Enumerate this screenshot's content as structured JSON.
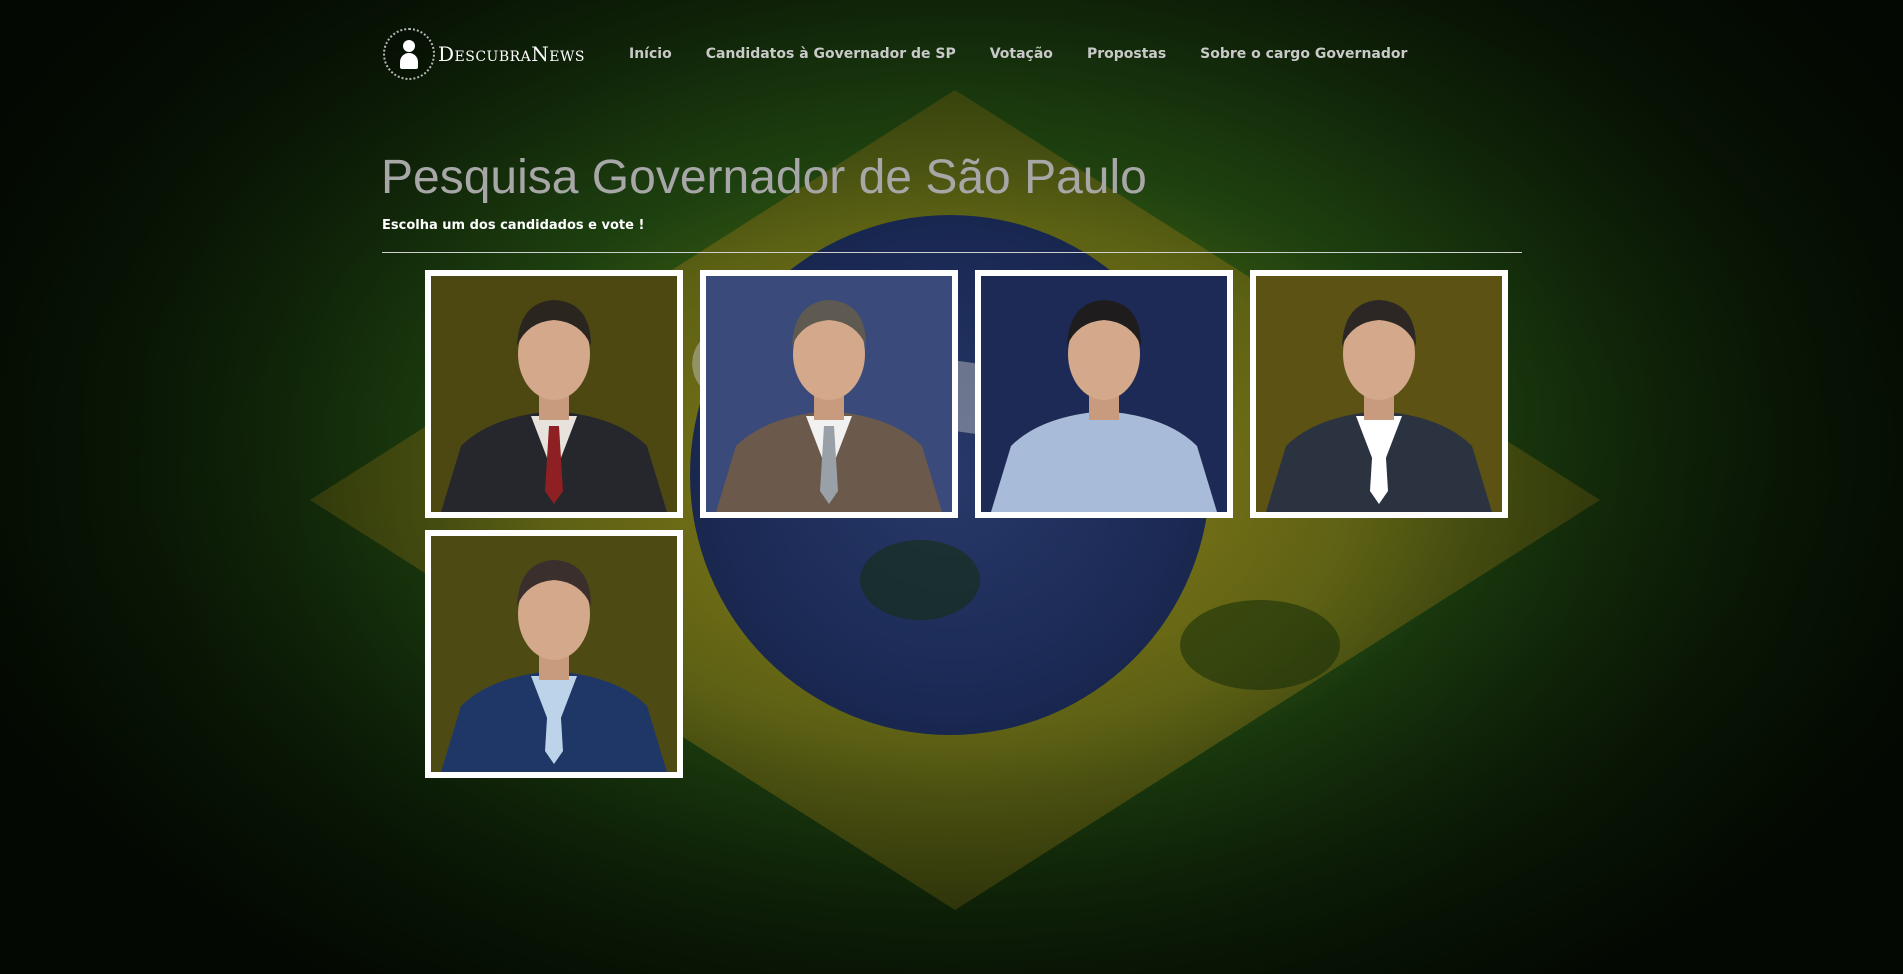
{
  "header": {
    "logo_text": "DescubraNews",
    "nav": [
      {
        "label": "Início"
      },
      {
        "label": "Candidatos à Governador de SP"
      },
      {
        "label": "Votação"
      },
      {
        "label": "Propostas"
      },
      {
        "label": "Sobre o cargo Governador"
      }
    ]
  },
  "hero": {
    "title": "Pesquisa Governador de São Paulo",
    "subtitle": "Escolha um dos candidados e vote !"
  },
  "candidates": [
    {
      "photo": "candidate-photo",
      "hair": "#2b2520",
      "suit": "#25272c",
      "shirt": "#e7e3dc",
      "tie": "#8e1f22",
      "bg": "#4d4812"
    },
    {
      "photo": "candidate-photo",
      "hair": "#5e5a52",
      "suit": "#6b5a4c",
      "shirt": "#f1f1f1",
      "tie": "#9aa0a8",
      "bg": "#3a4a7a"
    },
    {
      "photo": "candidate-photo",
      "hair": "#1e1c1c",
      "suit": "#a8bbd8",
      "shirt": "#a8bbd8",
      "tie": "#a8bbd8",
      "bg": "#1d2a55"
    },
    {
      "photo": "candidate-photo",
      "hair": "#2c2724",
      "suit": "#2c3340",
      "shirt": "#ffffff",
      "tie": "#ffffff",
      "bg": "#5b5214"
    },
    {
      "photo": "candidate-photo",
      "hair": "#3a2f2c",
      "suit": "#1f3766",
      "shirt": "#bcd3ea",
      "tie": "#bcd3ea",
      "bg": "#4e4a14"
    }
  ],
  "colors": {
    "background_green": "#1f4410",
    "flag_yellow": "#968214",
    "flag_blue": "#14245a",
    "card_border": "#ffffff",
    "nav_text": "#c9c9c9",
    "title_text": "#a7a7a7"
  }
}
